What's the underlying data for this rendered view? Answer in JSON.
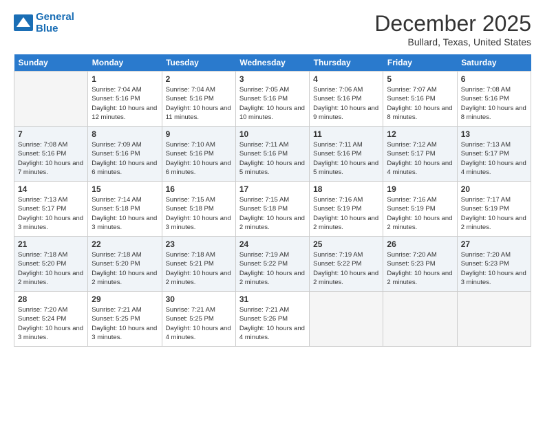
{
  "header": {
    "logo_line1": "General",
    "logo_line2": "Blue",
    "month": "December 2025",
    "location": "Bullard, Texas, United States"
  },
  "days": [
    "Sunday",
    "Monday",
    "Tuesday",
    "Wednesday",
    "Thursday",
    "Friday",
    "Saturday"
  ],
  "weeks": [
    [
      {
        "num": "",
        "sunrise": "",
        "sunset": "",
        "daylight": "",
        "empty": true
      },
      {
        "num": "1",
        "sunrise": "Sunrise: 7:04 AM",
        "sunset": "Sunset: 5:16 PM",
        "daylight": "Daylight: 10 hours and 12 minutes."
      },
      {
        "num": "2",
        "sunrise": "Sunrise: 7:04 AM",
        "sunset": "Sunset: 5:16 PM",
        "daylight": "Daylight: 10 hours and 11 minutes."
      },
      {
        "num": "3",
        "sunrise": "Sunrise: 7:05 AM",
        "sunset": "Sunset: 5:16 PM",
        "daylight": "Daylight: 10 hours and 10 minutes."
      },
      {
        "num": "4",
        "sunrise": "Sunrise: 7:06 AM",
        "sunset": "Sunset: 5:16 PM",
        "daylight": "Daylight: 10 hours and 9 minutes."
      },
      {
        "num": "5",
        "sunrise": "Sunrise: 7:07 AM",
        "sunset": "Sunset: 5:16 PM",
        "daylight": "Daylight: 10 hours and 8 minutes."
      },
      {
        "num": "6",
        "sunrise": "Sunrise: 7:08 AM",
        "sunset": "Sunset: 5:16 PM",
        "daylight": "Daylight: 10 hours and 8 minutes."
      }
    ],
    [
      {
        "num": "7",
        "sunrise": "Sunrise: 7:08 AM",
        "sunset": "Sunset: 5:16 PM",
        "daylight": "Daylight: 10 hours and 7 minutes."
      },
      {
        "num": "8",
        "sunrise": "Sunrise: 7:09 AM",
        "sunset": "Sunset: 5:16 PM",
        "daylight": "Daylight: 10 hours and 6 minutes."
      },
      {
        "num": "9",
        "sunrise": "Sunrise: 7:10 AM",
        "sunset": "Sunset: 5:16 PM",
        "daylight": "Daylight: 10 hours and 6 minutes."
      },
      {
        "num": "10",
        "sunrise": "Sunrise: 7:11 AM",
        "sunset": "Sunset: 5:16 PM",
        "daylight": "Daylight: 10 hours and 5 minutes."
      },
      {
        "num": "11",
        "sunrise": "Sunrise: 7:11 AM",
        "sunset": "Sunset: 5:16 PM",
        "daylight": "Daylight: 10 hours and 5 minutes."
      },
      {
        "num": "12",
        "sunrise": "Sunrise: 7:12 AM",
        "sunset": "Sunset: 5:17 PM",
        "daylight": "Daylight: 10 hours and 4 minutes."
      },
      {
        "num": "13",
        "sunrise": "Sunrise: 7:13 AM",
        "sunset": "Sunset: 5:17 PM",
        "daylight": "Daylight: 10 hours and 4 minutes."
      }
    ],
    [
      {
        "num": "14",
        "sunrise": "Sunrise: 7:13 AM",
        "sunset": "Sunset: 5:17 PM",
        "daylight": "Daylight: 10 hours and 3 minutes."
      },
      {
        "num": "15",
        "sunrise": "Sunrise: 7:14 AM",
        "sunset": "Sunset: 5:18 PM",
        "daylight": "Daylight: 10 hours and 3 minutes."
      },
      {
        "num": "16",
        "sunrise": "Sunrise: 7:15 AM",
        "sunset": "Sunset: 5:18 PM",
        "daylight": "Daylight: 10 hours and 3 minutes."
      },
      {
        "num": "17",
        "sunrise": "Sunrise: 7:15 AM",
        "sunset": "Sunset: 5:18 PM",
        "daylight": "Daylight: 10 hours and 2 minutes."
      },
      {
        "num": "18",
        "sunrise": "Sunrise: 7:16 AM",
        "sunset": "Sunset: 5:19 PM",
        "daylight": "Daylight: 10 hours and 2 minutes."
      },
      {
        "num": "19",
        "sunrise": "Sunrise: 7:16 AM",
        "sunset": "Sunset: 5:19 PM",
        "daylight": "Daylight: 10 hours and 2 minutes."
      },
      {
        "num": "20",
        "sunrise": "Sunrise: 7:17 AM",
        "sunset": "Sunset: 5:19 PM",
        "daylight": "Daylight: 10 hours and 2 minutes."
      }
    ],
    [
      {
        "num": "21",
        "sunrise": "Sunrise: 7:18 AM",
        "sunset": "Sunset: 5:20 PM",
        "daylight": "Daylight: 10 hours and 2 minutes."
      },
      {
        "num": "22",
        "sunrise": "Sunrise: 7:18 AM",
        "sunset": "Sunset: 5:20 PM",
        "daylight": "Daylight: 10 hours and 2 minutes."
      },
      {
        "num": "23",
        "sunrise": "Sunrise: 7:18 AM",
        "sunset": "Sunset: 5:21 PM",
        "daylight": "Daylight: 10 hours and 2 minutes."
      },
      {
        "num": "24",
        "sunrise": "Sunrise: 7:19 AM",
        "sunset": "Sunset: 5:22 PM",
        "daylight": "Daylight: 10 hours and 2 minutes."
      },
      {
        "num": "25",
        "sunrise": "Sunrise: 7:19 AM",
        "sunset": "Sunset: 5:22 PM",
        "daylight": "Daylight: 10 hours and 2 minutes."
      },
      {
        "num": "26",
        "sunrise": "Sunrise: 7:20 AM",
        "sunset": "Sunset: 5:23 PM",
        "daylight": "Daylight: 10 hours and 2 minutes."
      },
      {
        "num": "27",
        "sunrise": "Sunrise: 7:20 AM",
        "sunset": "Sunset: 5:23 PM",
        "daylight": "Daylight: 10 hours and 3 minutes."
      }
    ],
    [
      {
        "num": "28",
        "sunrise": "Sunrise: 7:20 AM",
        "sunset": "Sunset: 5:24 PM",
        "daylight": "Daylight: 10 hours and 3 minutes."
      },
      {
        "num": "29",
        "sunrise": "Sunrise: 7:21 AM",
        "sunset": "Sunset: 5:25 PM",
        "daylight": "Daylight: 10 hours and 3 minutes."
      },
      {
        "num": "30",
        "sunrise": "Sunrise: 7:21 AM",
        "sunset": "Sunset: 5:25 PM",
        "daylight": "Daylight: 10 hours and 4 minutes."
      },
      {
        "num": "31",
        "sunrise": "Sunrise: 7:21 AM",
        "sunset": "Sunset: 5:26 PM",
        "daylight": "Daylight: 10 hours and 4 minutes."
      },
      {
        "num": "",
        "sunrise": "",
        "sunset": "",
        "daylight": "",
        "empty": true
      },
      {
        "num": "",
        "sunrise": "",
        "sunset": "",
        "daylight": "",
        "empty": true
      },
      {
        "num": "",
        "sunrise": "",
        "sunset": "",
        "daylight": "",
        "empty": true
      }
    ]
  ]
}
